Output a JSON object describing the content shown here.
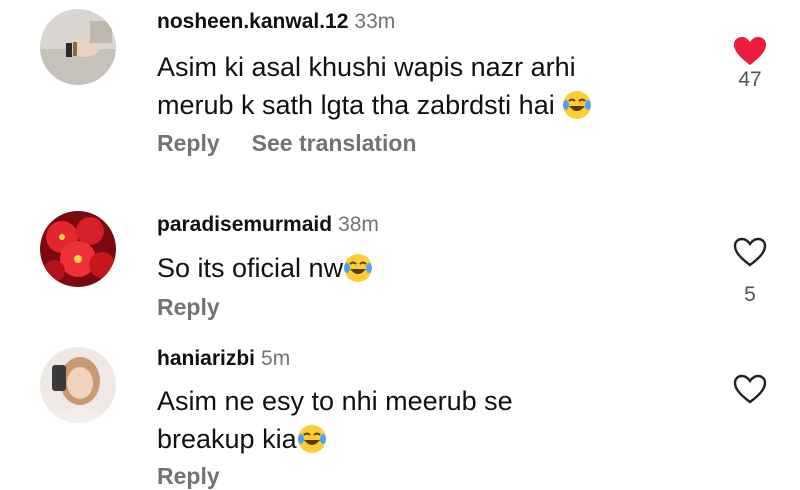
{
  "comments": [
    {
      "username": "nosheen.kanwal.12",
      "time": "33m",
      "text_line1": "Asim ki asal khushi wapis nazr arhi",
      "text_line2": "merub k sath lgta tha zabrdsti hai",
      "reply_label": "Reply",
      "translate_label": "See translation",
      "likes": "47",
      "liked": true,
      "avatar": "avatar-photo-hand"
    },
    {
      "username": "paradisemurmaid",
      "time": "38m",
      "text_line1": "So its oficial nw",
      "reply_label": "Reply",
      "likes": "5",
      "liked": false,
      "avatar": "avatar-red-flowers"
    },
    {
      "username": "haniarizbi",
      "time": "5m",
      "text_line1": "Asim ne esy to nhi meerub se",
      "text_line2": "breakup kia",
      "reply_label": "Reply",
      "liked": false,
      "avatar": "avatar-selfie"
    }
  ],
  "colors": {
    "text": "#111111",
    "muted": "#737373",
    "heart_liked": "#ed1c3c",
    "emoji_face": "#ffcc33"
  }
}
